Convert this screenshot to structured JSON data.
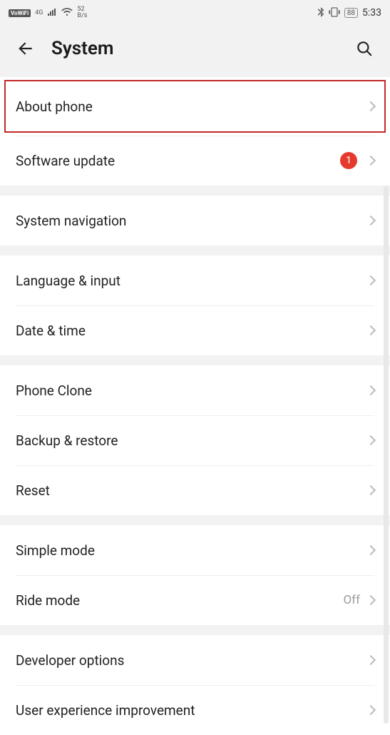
{
  "status": {
    "vowifi": "VoWiFi",
    "net_label": "4G",
    "speed_top": "52",
    "speed_bottom": "B/s",
    "battery": "88",
    "time": "5:33"
  },
  "header": {
    "title": "System"
  },
  "groups": [
    {
      "rows": [
        {
          "key": "about-phone",
          "label": "About phone",
          "highlighted": true
        },
        {
          "key": "software-update",
          "label": "Software update",
          "badge": "1"
        }
      ]
    },
    {
      "rows": [
        {
          "key": "system-navigation",
          "label": "System navigation"
        }
      ]
    },
    {
      "rows": [
        {
          "key": "language-input",
          "label": "Language & input"
        },
        {
          "key": "date-time",
          "label": "Date & time"
        }
      ]
    },
    {
      "rows": [
        {
          "key": "phone-clone",
          "label": "Phone Clone"
        },
        {
          "key": "backup-restore",
          "label": "Backup & restore"
        },
        {
          "key": "reset",
          "label": "Reset"
        }
      ]
    },
    {
      "rows": [
        {
          "key": "simple-mode",
          "label": "Simple mode"
        },
        {
          "key": "ride-mode",
          "label": "Ride mode",
          "value": "Off"
        }
      ]
    },
    {
      "rows": [
        {
          "key": "developer-options",
          "label": "Developer options"
        },
        {
          "key": "user-experience-improvement",
          "label": "User experience improvement"
        }
      ]
    }
  ]
}
